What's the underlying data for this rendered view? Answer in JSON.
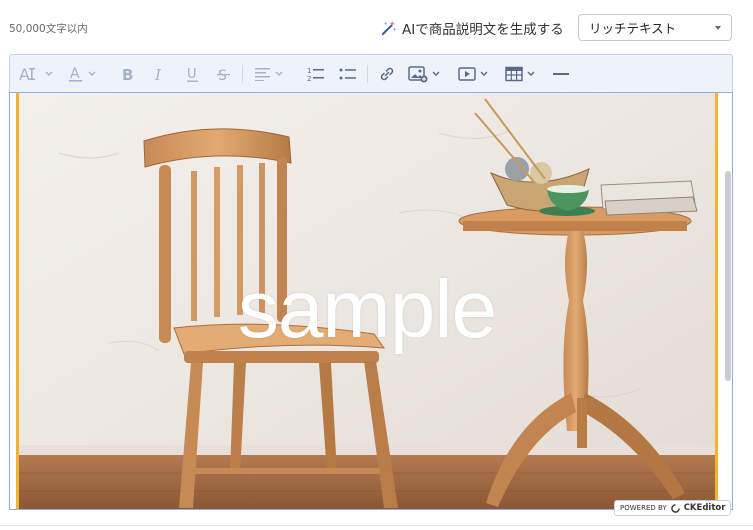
{
  "header": {
    "char_limit": "50,000文字以内",
    "ai_generate_label": "AIで商品説明文を生成する",
    "editor_mode": {
      "selected": "リッチテキスト"
    }
  },
  "toolbar": {
    "items": [
      {
        "name": "font-size-icon",
        "glyph": "AI"
      },
      {
        "name": "font-color-icon",
        "glyph": "A"
      },
      {
        "name": "bold-icon",
        "glyph": "B"
      },
      {
        "name": "italic-icon",
        "glyph": "I"
      },
      {
        "name": "underline-icon",
        "glyph": "U"
      },
      {
        "name": "strikethrough-icon",
        "glyph": "S"
      },
      {
        "name": "align-icon"
      },
      {
        "name": "numbered-list-icon",
        "glyph": "12"
      },
      {
        "name": "bulleted-list-icon"
      },
      {
        "name": "link-icon"
      },
      {
        "name": "insert-image-icon"
      },
      {
        "name": "insert-media-icon"
      },
      {
        "name": "insert-table-icon"
      },
      {
        "name": "horizontal-line-icon"
      }
    ],
    "icon_color": "#a5b1c4",
    "background": "#eef3fb"
  },
  "editor": {
    "image_watermark": "sample",
    "selection_border_color": "#f2b32e",
    "focus_border_color": "#8fb0e6"
  },
  "footer": {
    "powered_by": "POWERED BY",
    "brand": "CKEditor"
  }
}
